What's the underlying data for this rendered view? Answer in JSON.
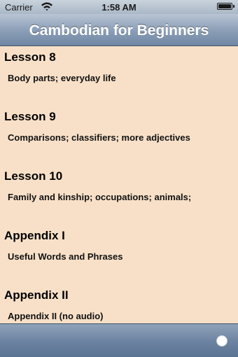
{
  "status_bar": {
    "carrier": "Carrier",
    "time": "1:58 AM",
    "wifi_icon": "wifi-icon",
    "battery_icon": "battery-icon",
    "battery_level": 1.0
  },
  "nav": {
    "title": "Cambodian for Beginners"
  },
  "lessons": [
    {
      "title": "Lesson 8",
      "subtitle": "Body parts; everyday life"
    },
    {
      "title": "Lesson 9",
      "subtitle": "Comparisons; classifiers; more adjectives"
    },
    {
      "title": "Lesson 10",
      "subtitle": "Family and kinship; occupations; animals;"
    },
    {
      "title": "Appendix I",
      "subtitle": "Useful Words and Phrases"
    },
    {
      "title": "Appendix II",
      "subtitle": "Appendix II (no audio)"
    }
  ],
  "toolbar": {
    "button_icon": "circle-icon"
  },
  "colors": {
    "background": "#f8e0c8",
    "nav_title": "#ffffff"
  }
}
